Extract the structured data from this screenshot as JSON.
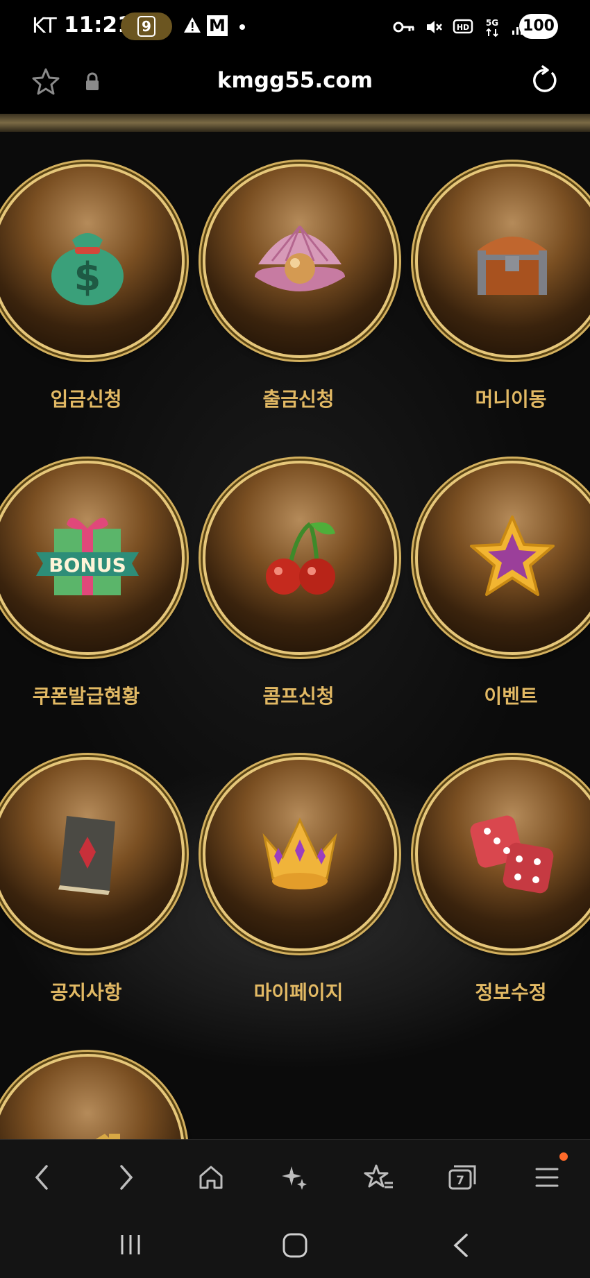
{
  "status_bar": {
    "carrier": "KT",
    "time": "11:21",
    "app_badge": "9",
    "mail_icon": "M",
    "battery": "100"
  },
  "browser": {
    "url": "kmgg55.com",
    "tabs_count": "7"
  },
  "menu": [
    {
      "label": "입금신청",
      "icon": "money-bag-icon"
    },
    {
      "label": "출금신청",
      "icon": "pearl-shell-icon"
    },
    {
      "label": "머니이동",
      "icon": "treasure-chest-icon"
    },
    {
      "label": "쿠폰발급현황",
      "icon": "bonus-gift-icon"
    },
    {
      "label": "콤프신청",
      "icon": "cherry-icon"
    },
    {
      "label": "이벤트",
      "icon": "star-icon"
    },
    {
      "label": "공지사항",
      "icon": "book-icon"
    },
    {
      "label": "마이페이지",
      "icon": "crown-icon"
    },
    {
      "label": "정보수정",
      "icon": "dice-icon"
    }
  ],
  "bonus_text": "BONUS",
  "colors": {
    "label_gold": "#e2b964",
    "ring_gold": "#e6c77a",
    "notification_dot": "#ff6a2a"
  }
}
